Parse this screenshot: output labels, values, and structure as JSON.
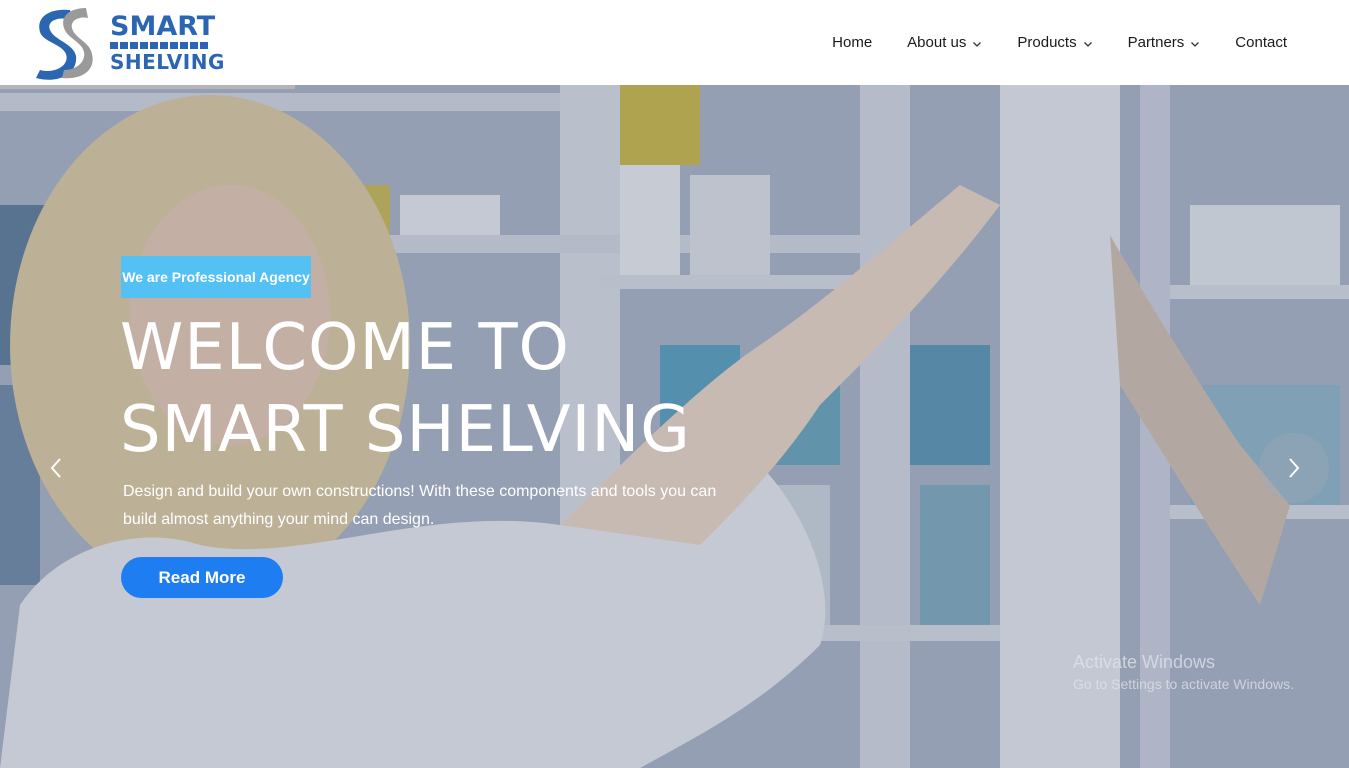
{
  "brand": {
    "name_line1": "SMART",
    "name_line2": "SHELVING",
    "primary_color": "#2b66b3",
    "accent_color": "#1f7df2",
    "badge_color": "#53c1f3"
  },
  "nav": {
    "items": [
      {
        "label": "Home",
        "has_dropdown": false
      },
      {
        "label": "About us",
        "has_dropdown": true
      },
      {
        "label": "Products",
        "has_dropdown": true
      },
      {
        "label": "Partners",
        "has_dropdown": true
      },
      {
        "label": "Contact",
        "has_dropdown": false
      }
    ]
  },
  "hero": {
    "badge": "We are Professional Agency",
    "headline_line1": "WELCOME TO",
    "headline_line2": "SMART SHELVING",
    "subtitle": "Design and build your own constructions! With these components and tools you can build almost anything your mind can design.",
    "cta_label": "Read More",
    "prev_icon": "chevron-left-icon",
    "next_icon": "chevron-right-icon"
  },
  "watermark": {
    "line1": "Activate Windows",
    "line2": "Go to Settings to activate Windows."
  }
}
